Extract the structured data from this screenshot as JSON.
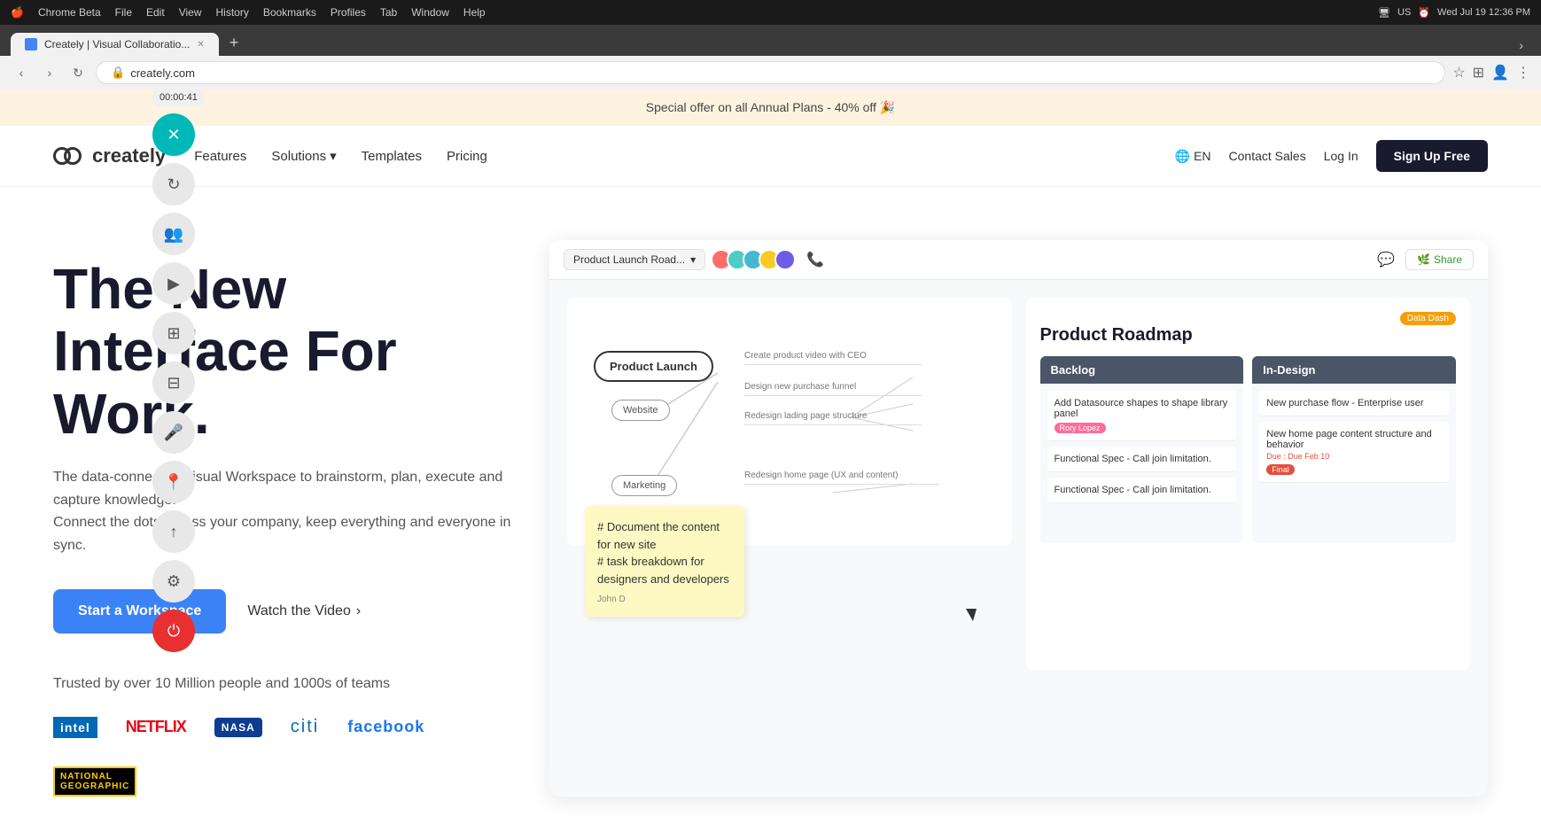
{
  "macbar": {
    "apple": "🍎",
    "app": "Chrome Beta",
    "menus": [
      "File",
      "Edit",
      "View",
      "History",
      "Bookmarks",
      "Profiles",
      "Tab",
      "Window",
      "Help"
    ],
    "time": "Wed Jul 19  12:36 PM"
  },
  "browser": {
    "tab_title": "Creately | Visual Collaboratio...",
    "url": "creately.com",
    "timer": "00:00:41"
  },
  "promo_banner": {
    "text": "Special offer on all Annual Plans - 40% off 🎉"
  },
  "nav": {
    "logo_text": "creately",
    "features": "Features",
    "solutions": "Solutions",
    "templates": "Templates",
    "pricing": "Pricing",
    "language": "EN",
    "contact_sales": "Contact Sales",
    "login": "Log In",
    "signup": "Sign Up Free"
  },
  "hero": {
    "title": "The New Interface For Work.",
    "description": "The data-connected Visual Workspace to brainstorm, plan, execute and capture knowledge.\nConnect the dots across your company, keep everything and everyone in sync.",
    "cta_primary": "Start a Workspace",
    "cta_video": "Watch the Video",
    "trust_text": "Trusted by over 10 Million people and 1000s of teams",
    "trust_logos": [
      "intel",
      "NETFLIX",
      "NASA",
      "citi",
      "facebook",
      "NATIONAL GEOGRAPHIC"
    ]
  },
  "app_mockup": {
    "workspace_name": "Product Launch Road...",
    "share_label": "Share",
    "mindmap": {
      "center": "Product Launch",
      "nodes": [
        "Website",
        "Marketing"
      ],
      "tasks": [
        "Create product video with CEO",
        "Design new purchase funnel",
        "Redesign lading page structure",
        "Redesign home page (UX and content)"
      ]
    },
    "sticky_note": {
      "text": "# Document the content for new site\n# task breakdown for designers and developers",
      "author": "John D"
    },
    "roadmap": {
      "badge": "Data Dash",
      "title": "Product Roadmap",
      "columns": [
        {
          "name": "Backlog",
          "items": [
            {
              "text": "Add Datasource shapes to shape library panel",
              "tag": "Rory Lopez",
              "tag_type": "pink"
            },
            {
              "text": "Functional Spec - Call join limitation."
            },
            {
              "text": "Functional Spec - Call join limitation."
            }
          ]
        },
        {
          "name": "In-Design",
          "items": [
            {
              "text": "New purchase flow - Enterprise user"
            },
            {
              "text": "New home page content structure and behavior",
              "due": "Due : Due Feb 10",
              "tag": "Final",
              "tag_type": "red"
            }
          ]
        }
      ]
    }
  },
  "sidebar": {
    "timer": "00:00:41",
    "buttons": [
      {
        "id": "close",
        "symbol": "✕",
        "style": "red"
      },
      {
        "id": "sync",
        "symbol": "↻",
        "style": "gray"
      },
      {
        "id": "users",
        "symbol": "👥",
        "style": "gray"
      },
      {
        "id": "video",
        "symbol": "▶",
        "style": "gray"
      },
      {
        "id": "layers",
        "symbol": "⊞",
        "style": "gray"
      },
      {
        "id": "screen",
        "symbol": "⊟",
        "style": "gray"
      },
      {
        "id": "mic",
        "symbol": "🎤",
        "style": "gray"
      },
      {
        "id": "pin",
        "symbol": "📍",
        "style": "gray"
      },
      {
        "id": "upload",
        "symbol": "↑",
        "style": "gray"
      },
      {
        "id": "settings",
        "symbol": "⚙",
        "style": "gray"
      },
      {
        "id": "power",
        "symbol": "⏻",
        "style": "red"
      }
    ]
  }
}
